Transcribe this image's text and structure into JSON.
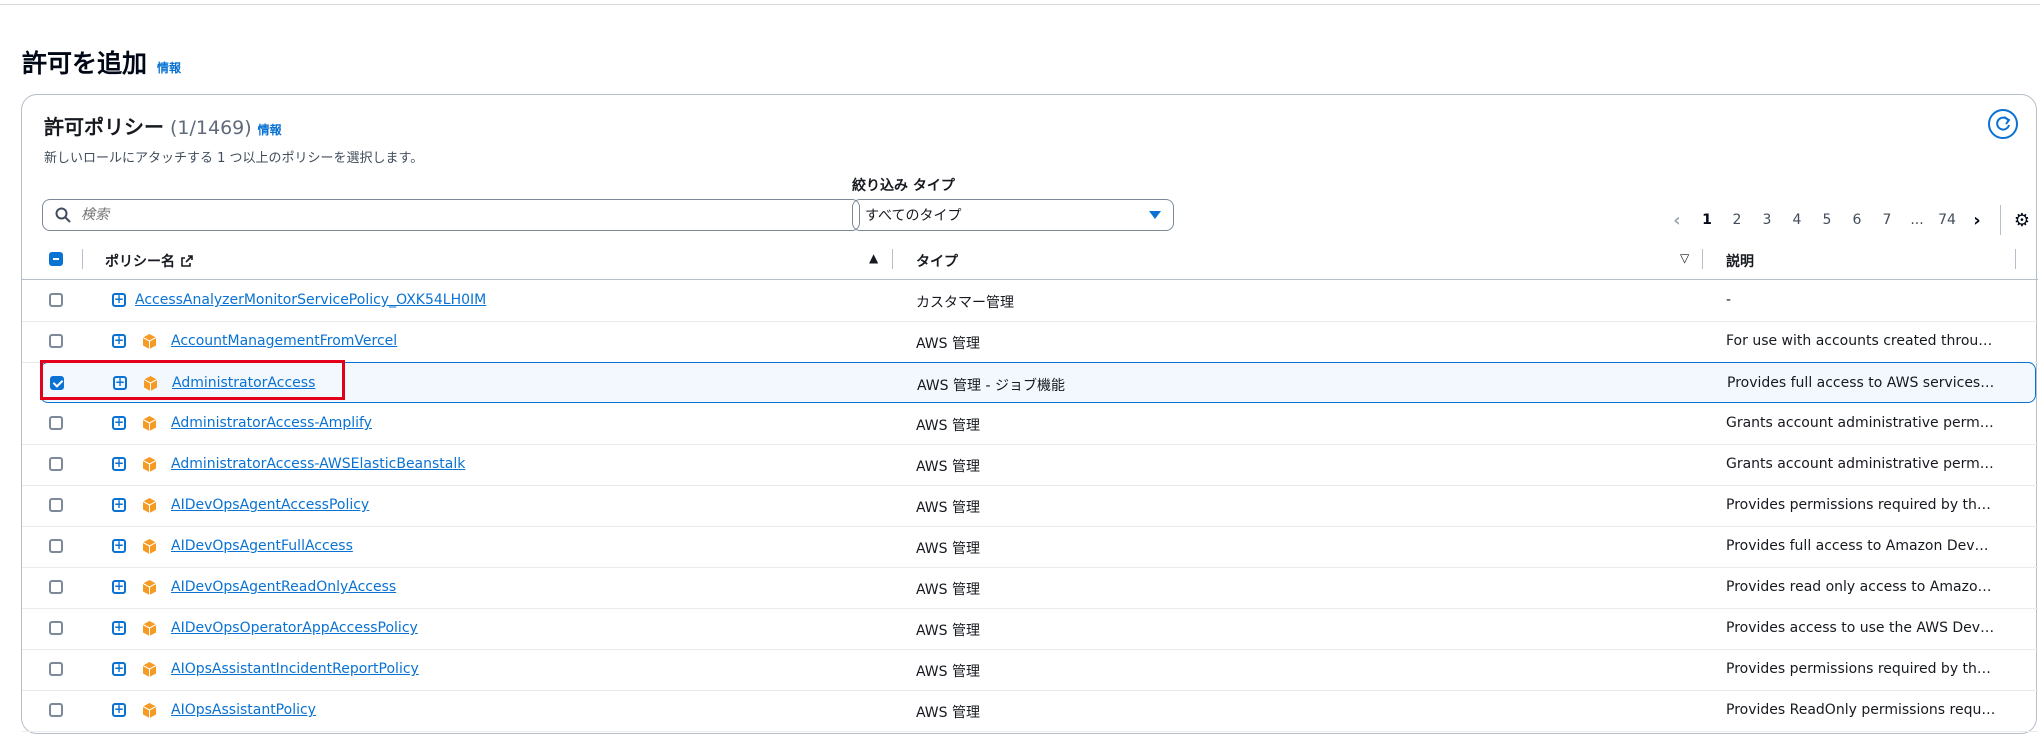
{
  "page": {
    "title": "許可を追加",
    "info": "情報"
  },
  "section": {
    "title": "許可ポリシー",
    "count": "(1/1469)",
    "info": "情報",
    "description": "新しいロールにアタッチする 1 つ以上のポリシーを選択します。"
  },
  "search": {
    "placeholder": "検索",
    "value": ""
  },
  "filter": {
    "label": "絞り込み タイプ",
    "selected": "すべてのタイプ"
  },
  "pagination": {
    "pages": [
      "1",
      "2",
      "3",
      "4",
      "5",
      "6",
      "7",
      "...",
      "74"
    ],
    "current": "1"
  },
  "columns": {
    "name": "ポリシー名",
    "type": "タイプ",
    "description": "説明"
  },
  "rows": [
    {
      "name": "AccessAnalyzerMonitorServicePolicy_OXK54LH0IM",
      "type": "カスタマー管理",
      "description": "-",
      "checked": false,
      "aws_managed": false
    },
    {
      "name": "AccountManagementFromVercel",
      "type": "AWS 管理",
      "description": "For use with accounts created through ...",
      "checked": false,
      "aws_managed": true
    },
    {
      "name": "AdministratorAccess",
      "type": "AWS 管理 - ジョブ機能",
      "description": "Provides full access to AWS services an...",
      "checked": true,
      "aws_managed": true
    },
    {
      "name": "AdministratorAccess-Amplify",
      "type": "AWS 管理",
      "description": "Grants account administrative permissi...",
      "checked": false,
      "aws_managed": true
    },
    {
      "name": "AdministratorAccess-AWSElasticBeanstalk",
      "type": "AWS 管理",
      "description": "Grants account administrative permissi...",
      "checked": false,
      "aws_managed": true
    },
    {
      "name": "AIDevOpsAgentAccessPolicy",
      "type": "AWS 管理",
      "description": "Provides permissions required by the A...",
      "checked": false,
      "aws_managed": true
    },
    {
      "name": "AIDevOpsAgentFullAccess",
      "type": "AWS 管理",
      "description": "Provides full access to Amazon DevOp...",
      "checked": false,
      "aws_managed": true
    },
    {
      "name": "AIDevOpsAgentReadOnlyAccess",
      "type": "AWS 管理",
      "description": "Provides read only access to Amazon D...",
      "checked": false,
      "aws_managed": true
    },
    {
      "name": "AIDevOpsOperatorAppAccessPolicy",
      "type": "AWS 管理",
      "description": "Provides access to use the AWS DevOp...",
      "checked": false,
      "aws_managed": true
    },
    {
      "name": "AIOpsAssistantIncidentReportPolicy",
      "type": "AWS 管理",
      "description": "Provides permissions required by the A...",
      "checked": false,
      "aws_managed": true
    },
    {
      "name": "AIOpsAssistantPolicy",
      "type": "AWS 管理",
      "description": "Provides ReadOnly permissions required...",
      "checked": false,
      "aws_managed": true
    }
  ],
  "colors": {
    "accent": "#0972d3",
    "aws_icon": "#f59b23",
    "highlight": "#e3001b"
  },
  "icons": {
    "search": "search-icon",
    "refresh": "refresh-icon",
    "settings": "gear-icon",
    "external": "external-link-icon"
  }
}
